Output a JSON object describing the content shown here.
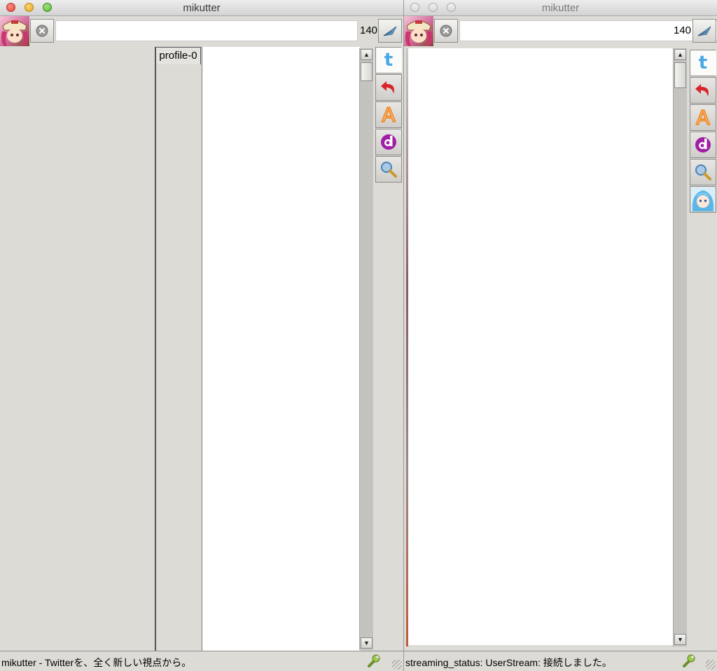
{
  "left_window": {
    "title": "mikutter",
    "char_count": "140",
    "post_text": "",
    "profile_tab_label": "profile-0",
    "status_message": "mikutter - Twitterを、全く新しい視点から。"
  },
  "right_window": {
    "title": "mikutter",
    "char_count": "140",
    "post_text": "",
    "status_message": "streaming_status: UserStream: 接続しました。"
  },
  "tabs": [
    {
      "icon": "twitter-bird-icon",
      "glyph": "t",
      "color": "#49a9e6"
    },
    {
      "icon": "reply-arrow-icon",
      "color": "#d9242a"
    },
    {
      "icon": "letter-a-icon",
      "glyph": "A",
      "color": "#f08a26"
    },
    {
      "icon": "d-icon",
      "glyph": "d",
      "color": "#a01fa5"
    },
    {
      "icon": "search-magnifier-icon",
      "color": "#4a82b6"
    },
    {
      "icon": "user-avatar-icon",
      "color": "#5db6e6"
    }
  ],
  "colors": {
    "window_bg": "#dcdbd6",
    "timeline_bg": "#ffffff"
  }
}
